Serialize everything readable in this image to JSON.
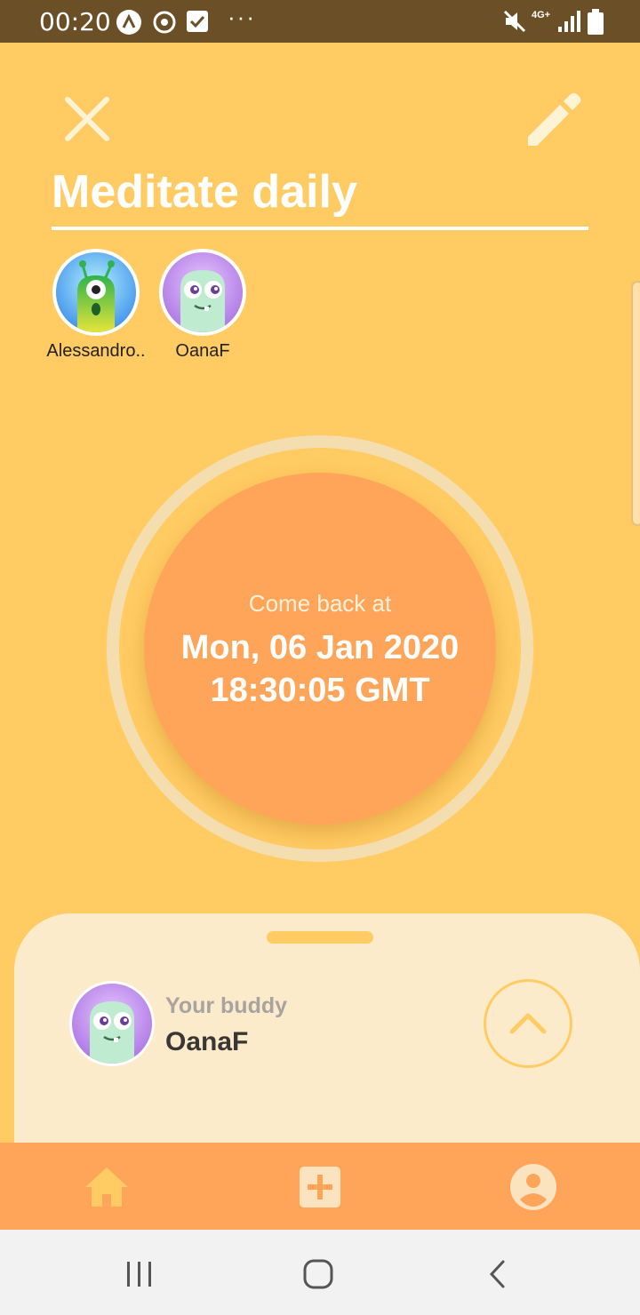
{
  "status_bar": {
    "time": "00:20",
    "dots": "···",
    "network": "4G+"
  },
  "habit": {
    "title": "Meditate daily"
  },
  "members": [
    {
      "name": "Alessandro..",
      "avatar": "green-alien-avatar"
    },
    {
      "name": "OanaF",
      "avatar": "purple-monster-avatar"
    }
  ],
  "countdown": {
    "label": "Come back at",
    "date": "Mon, 06 Jan 2020",
    "time": "18:30:05 GMT"
  },
  "buddy": {
    "label": "Your buddy",
    "name": "OanaF",
    "avatar": "purple-monster-avatar"
  },
  "bottom_nav": [
    "home-icon",
    "add-icon",
    "profile-icon"
  ],
  "system_nav": [
    "recent-apps-icon",
    "home-button-icon",
    "back-icon"
  ],
  "colors": {
    "background": "#FFCB62",
    "accent": "#FFA55A",
    "sheet": "#FBEBCB",
    "status_bar": "#6B4F26"
  }
}
